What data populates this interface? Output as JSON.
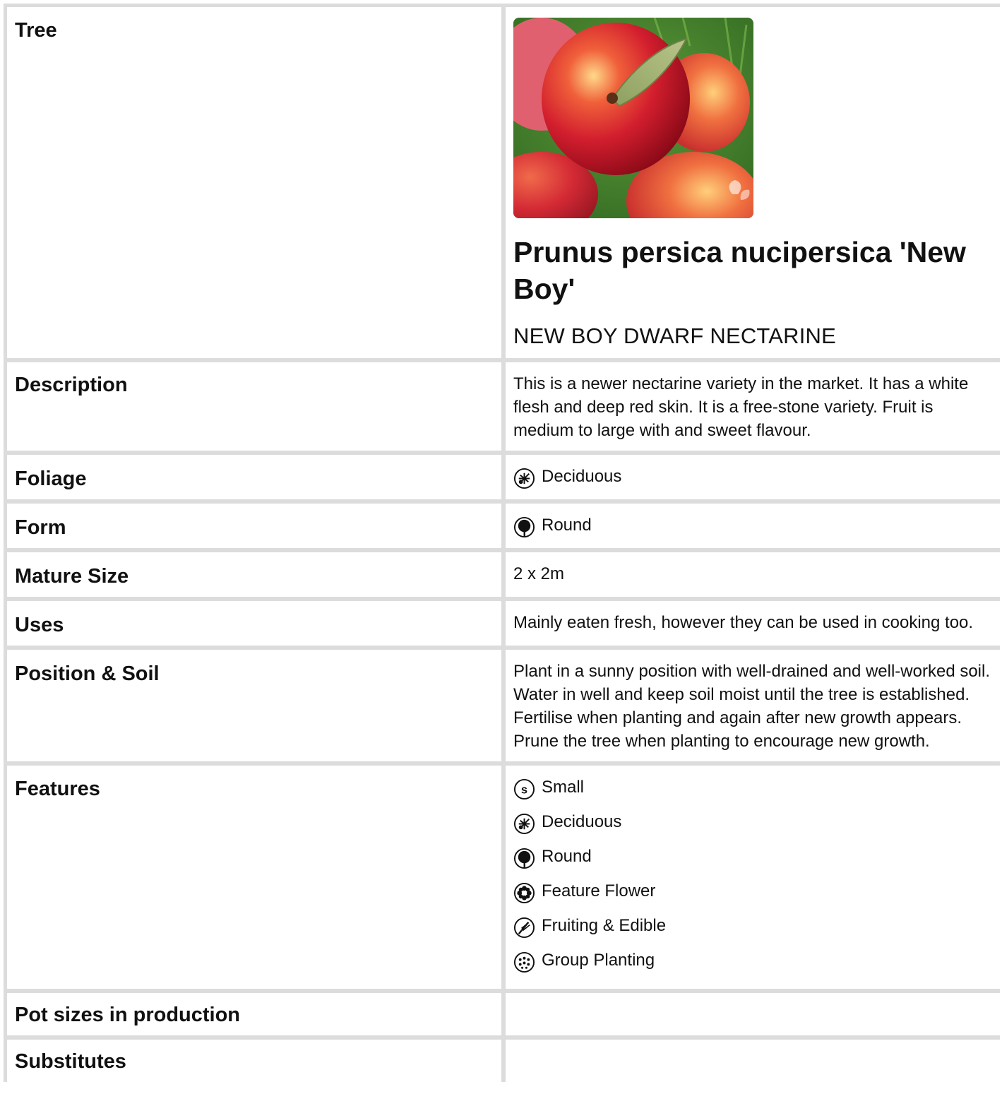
{
  "rows": {
    "tree": {
      "label": "Tree",
      "image_alt": "nectarine photo",
      "title": "Prunus persica nucipersica 'New Boy'",
      "common_name": "NEW BOY DWARF NECTARINE"
    },
    "description": {
      "label": "Description",
      "value": "This is a newer nectarine variety in the market. It has a white flesh and deep red skin. It is a free-stone variety. Fruit is medium to large with and sweet flavour."
    },
    "foliage": {
      "label": "Foliage",
      "icon": "deciduous-icon",
      "value": "Deciduous"
    },
    "form": {
      "label": "Form",
      "icon": "round-tree-icon",
      "value": "Round"
    },
    "mature_size": {
      "label": "Mature Size",
      "value": "2 x 2m"
    },
    "uses": {
      "label": "Uses",
      "value": "Mainly eaten fresh, however they can be used in cooking too."
    },
    "position_soil": {
      "label": "Position & Soil",
      "value": "Plant in a sunny position with well-drained and well-worked soil. Water in well and keep soil moist until the tree is established. Fertilise when planting and again after new growth appears. Prune the tree when planting to encourage new growth."
    },
    "features": {
      "label": "Features",
      "items": [
        {
          "icon": "small-icon",
          "label": "Small"
        },
        {
          "icon": "deciduous-icon",
          "label": "Deciduous"
        },
        {
          "icon": "round-tree-icon",
          "label": "Round"
        },
        {
          "icon": "feature-flower-icon",
          "label": "Feature Flower"
        },
        {
          "icon": "fruiting-edible-icon",
          "label": "Fruiting & Edible"
        },
        {
          "icon": "group-planting-icon",
          "label": "Group Planting"
        }
      ]
    },
    "pot_sizes": {
      "label": "Pot sizes in production",
      "value": ""
    },
    "substitutes": {
      "label": "Substitutes",
      "value": ""
    }
  },
  "colors": {
    "border": "#dcdcdc",
    "text": "#111111",
    "background": "#ffffff"
  }
}
